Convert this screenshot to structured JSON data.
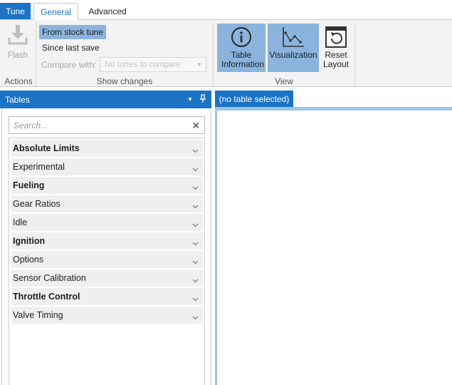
{
  "ribbon_tabs": {
    "tune": "Tune",
    "general": "General",
    "advanced": "Advanced"
  },
  "actions": {
    "flash_label": "Flash",
    "group_label": "Actions"
  },
  "show_changes": {
    "from_stock": "From stock tune",
    "since_last_save": "Since last save",
    "compare_with_label": "Compare with:",
    "compare_with_placeholder": "No tunes to compare",
    "group_label": "Show changes"
  },
  "view": {
    "table_information": "Table Information",
    "visualization": "Visualization",
    "reset_layout": "Reset Layout",
    "group_label": "View"
  },
  "tables_panel": {
    "title": "Tables",
    "search_placeholder": "Search...",
    "items": [
      {
        "label": "Absolute Limits",
        "bold": true
      },
      {
        "label": "Experimental",
        "bold": false
      },
      {
        "label": "Fueling",
        "bold": true
      },
      {
        "label": "Gear Ratios",
        "bold": false
      },
      {
        "label": "Idle",
        "bold": false
      },
      {
        "label": "Ignition",
        "bold": true
      },
      {
        "label": "Options",
        "bold": false
      },
      {
        "label": "Sensor Calibration",
        "bold": false
      },
      {
        "label": "Throttle Control",
        "bold": true
      },
      {
        "label": "Valve Timing",
        "bold": false
      }
    ]
  },
  "table_view": {
    "tab_label": "(no table selected)"
  },
  "colors": {
    "accent": "#1a73c5",
    "selected": "#8ab4de",
    "list_item_bg": "#efefef"
  }
}
